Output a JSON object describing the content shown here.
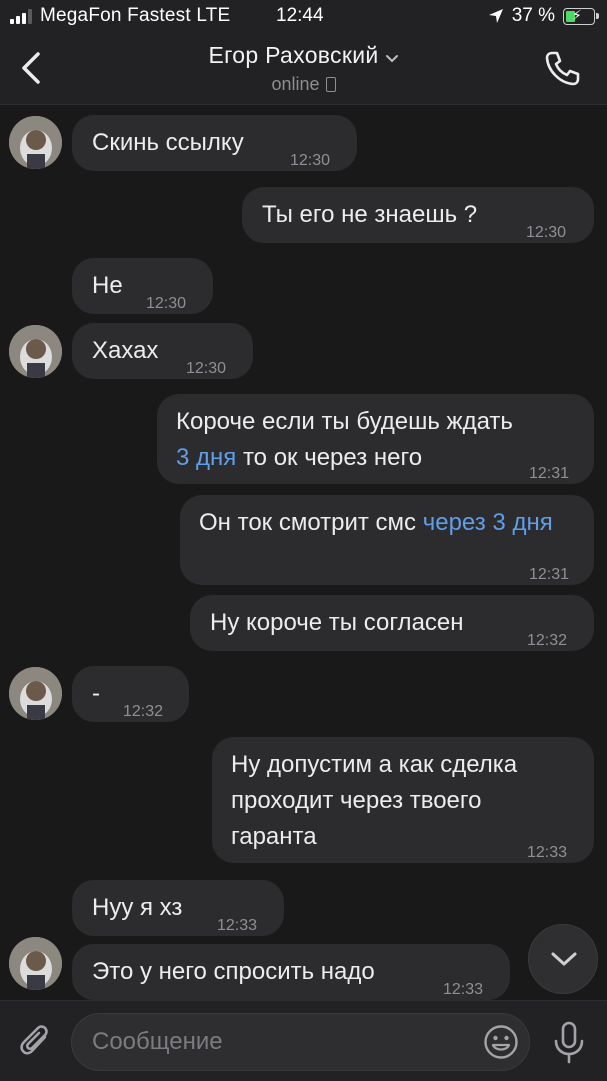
{
  "status_bar": {
    "carrier": "MegaFon Fastest LTE",
    "time": "12:44",
    "battery": "37 %",
    "battery_level": 0.37
  },
  "header": {
    "name": "Егор Раховский",
    "status": "online"
  },
  "messages": [
    {
      "dir": "in",
      "avatar": true,
      "text": "Скинь ссылку",
      "time": "12:30"
    },
    {
      "dir": "out",
      "text": "Ты его не знаешь ?",
      "time": "12:30"
    },
    {
      "dir": "in",
      "avatar": false,
      "text": "Не",
      "time": "12:30"
    },
    {
      "dir": "in",
      "avatar": true,
      "text": "Хахах",
      "time": "12:30"
    },
    {
      "dir": "out",
      "text_before": "Короче если ты будешь ждать",
      "link": "3 дня",
      "text_after": "то ок через него",
      "time": "12:31"
    },
    {
      "dir": "out",
      "text_before": "Он ток смотрит смс",
      "link": "через 3 дня",
      "time": "12:31"
    },
    {
      "dir": "out",
      "text": "Ну короче ты согласен",
      "time": "12:32"
    },
    {
      "dir": "in",
      "avatar": true,
      "text": "-",
      "time": "12:32"
    },
    {
      "dir": "out",
      "text_lines": [
        "Ну допустим а как сделка",
        "проходит через твоего",
        "гаранта"
      ],
      "time": "12:33"
    },
    {
      "dir": "in",
      "avatar": false,
      "text": "Нуу я хз",
      "time": "12:33"
    },
    {
      "dir": "in",
      "avatar": true,
      "text": "Это у него спросить надо",
      "time": "12:33"
    }
  ],
  "composer": {
    "placeholder": "Сообщение"
  },
  "icons": {
    "back": "chevron-left-icon",
    "dropdown": "chevron-down-icon",
    "call": "phone-icon",
    "scroll": "chevron-down-icon",
    "attach": "paperclip-icon",
    "emoji": "smile-icon",
    "mic": "microphone-icon"
  },
  "colors": {
    "background": "#19191a",
    "bubble": "#2c2c2e",
    "link": "#5f9ee8",
    "battery": "#4cd964"
  }
}
